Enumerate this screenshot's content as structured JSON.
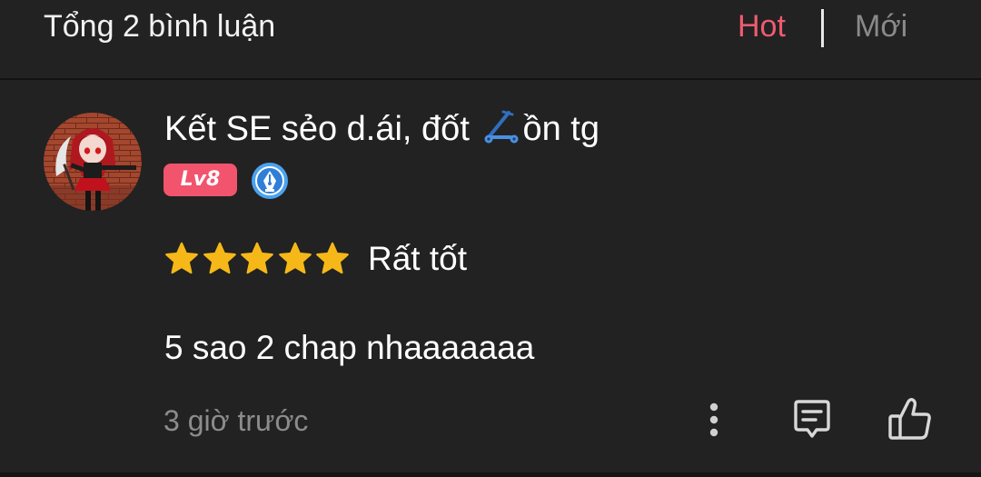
{
  "header": {
    "total_comments_label": "Tổng 2 bình luận",
    "sort_tabs": [
      {
        "label": "Hot",
        "active": true
      },
      {
        "label": "Mới",
        "active": false
      }
    ]
  },
  "comment": {
    "username_part1": "Kết SE sẻo d.ái, đốt ",
    "username_icon": "kick-scooter-icon",
    "username_part2": "ồn tg",
    "level_badge": "Lv8",
    "verified_icon": "pen-nib-badge-icon",
    "rating": 5,
    "rating_max": 5,
    "rating_label": "Rất tốt",
    "text": "5 sao 2 chap nhaaaaaaa",
    "timestamp": "3 giờ trước",
    "actions": [
      "more-vertical-icon",
      "reply-comment-icon",
      "thumbs-up-icon"
    ]
  },
  "colors": {
    "background": "#222222",
    "accent_active_tab": "#ef5b6f",
    "inactive_tab": "#8a8a8a",
    "level_badge": "#f2546d",
    "star": "#f6b818",
    "secondary_text": "#8c8c8c",
    "icon": "#d8d8d8"
  }
}
